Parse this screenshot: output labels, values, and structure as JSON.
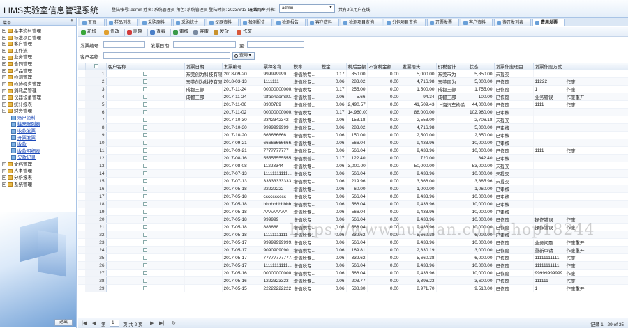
{
  "header": {
    "title": "LIMS实验室信息管理系统",
    "user_info": "登陆帐号: admin 姓名: 系统管理员 角色: 系统管理员 登陆时间: 2023/6/13 16:32:54",
    "switch_label": "在线用户列表:",
    "switch_value": "admin",
    "online_text": "共有2位用户在线"
  },
  "sidebar": {
    "title": "菜单",
    "collapse": "«",
    "logout": "退出",
    "items": [
      {
        "label": "基本资料管理",
        "level": 0,
        "exp": "+"
      },
      {
        "label": "标准项目管理",
        "level": 0,
        "exp": "+"
      },
      {
        "label": "客户管理",
        "level": 0,
        "exp": "+"
      },
      {
        "label": "工作流",
        "level": 0,
        "exp": "+"
      },
      {
        "label": "业务管理",
        "level": 0,
        "exp": "+"
      },
      {
        "label": "合同管理",
        "level": 0,
        "exp": "+"
      },
      {
        "label": "样品管理",
        "level": 0,
        "exp": "+"
      },
      {
        "label": "检测管理",
        "level": 0,
        "exp": "+"
      },
      {
        "label": "检验报告管理",
        "level": 0,
        "exp": "+"
      },
      {
        "label": "消耗品管理",
        "level": 0,
        "exp": "+"
      },
      {
        "label": "仪器设备管理",
        "level": 0,
        "exp": "+"
      },
      {
        "label": "统计报表",
        "level": 0,
        "exp": "+"
      },
      {
        "label": "财务管理",
        "level": 0,
        "exp": "-"
      },
      {
        "label": "账户资料",
        "level": 1
      },
      {
        "label": "往来账列表",
        "level": 1
      },
      {
        "label": "收款发票",
        "level": 1
      },
      {
        "label": "开票发票",
        "level": 1
      },
      {
        "label": "收款",
        "level": 1
      },
      {
        "label": "收款明细表",
        "level": 1
      },
      {
        "label": "欠款记录",
        "level": 1
      },
      {
        "label": "文档管理",
        "level": 0,
        "exp": "+"
      },
      {
        "label": "人事管理",
        "level": 0,
        "exp": "+"
      },
      {
        "label": "分析报表",
        "level": 0,
        "exp": "+"
      },
      {
        "label": "系统管理",
        "level": 0,
        "exp": "+"
      }
    ]
  },
  "tabs": [
    "首页",
    "样品列表",
    "采购原料",
    "采购统计",
    "仪器资料",
    "检测报告",
    "检测报告",
    "客户资料",
    "检测项目查询",
    "分包项目查询",
    "开票发票",
    "客户资料",
    "待开发列表",
    "费用发票"
  ],
  "toolbar": {
    "add": "新增",
    "edit": "修改",
    "delete": "删除",
    "view": "查看",
    "audit": "审核",
    "reaudit": "弃审",
    "issue": "发放",
    "void": "作废"
  },
  "filter": {
    "invoice_no_label": "发票编号:",
    "invoice_date_label": "发票日期:",
    "to_label": "至:",
    "customer_label": "客户名称:",
    "search": "查询"
  },
  "table": {
    "columns": [
      "",
      "",
      "客户名称",
      "发票日期",
      "发票编号",
      "票种名称",
      "税率",
      "税金",
      "税后金额",
      "不含税金额",
      "发票抬头",
      "价税合计",
      "状态",
      "发票作废理由",
      "发票作废方式"
    ],
    "rows": [
      [
        "1",
        "东莞创为科技有限公司",
        "2018-09-20",
        "999999999",
        "增值税专...",
        "0.17",
        "850.00",
        "0.00",
        "5,000.00",
        "东莞市为",
        "5,850.00",
        "未提交",
        "",
        ""
      ],
      [
        "2",
        "东莞创为科技有限公司",
        "2018-03-13",
        "1111111",
        "增值税专...",
        "0.06",
        "283.02",
        "0.00",
        "4,716.98",
        "东莞南为",
        "5,000.00",
        "已作废",
        "11222",
        "作废"
      ],
      [
        "3",
        "成都三部",
        "2017-11-24",
        "00000000000...",
        "增值税专...",
        "0.17",
        "255.00",
        "0.00",
        "1,500.00",
        "成都三部",
        "1,755.00",
        "已作废",
        "1",
        "作废"
      ],
      [
        "4",
        "成都三部",
        "2017-11-24",
        "fafaehaoma0...",
        "增值税普...",
        "0.06",
        "5.66",
        "0.00",
        "94.34",
        "成都三部",
        "100.00",
        "已作废",
        "业务错误",
        "作废重开"
      ],
      [
        "5",
        "",
        "2017-11-06",
        "8900789",
        "增值税普...",
        "0.06",
        "2,490.57",
        "0.00",
        "41,509.43",
        "上海汽车检验",
        "44,000.00",
        "已作废",
        "1111",
        "作废"
      ],
      [
        "6",
        "",
        "2017-11-02",
        "00000000000...",
        "增值税专...",
        "0.17",
        "14,960.00",
        "0.00",
        "88,000.00",
        "",
        "102,960.00",
        "已审核",
        "",
        ""
      ],
      [
        "7",
        "",
        "2017-10-30",
        "2342342342",
        "增值税专...",
        "0.06",
        "153.18",
        "0.00",
        "2,553.00",
        "",
        "2,706.18",
        "未提交",
        "",
        ""
      ],
      [
        "8",
        "",
        "2017-10-30",
        "9999999999",
        "增值税专...",
        "0.06",
        "283.02",
        "0.00",
        "4,716.98",
        "",
        "5,000.00",
        "已审核",
        "",
        ""
      ],
      [
        "9",
        "",
        "2017-10-20",
        "666666666",
        "增值税专...",
        "0.06",
        "150.00",
        "0.00",
        "2,500.00",
        "",
        "2,650.00",
        "已审核",
        "",
        ""
      ],
      [
        "10",
        "",
        "2017-09-21",
        "66666666666...",
        "增值税专...",
        "0.06",
        "566.04",
        "0.00",
        "9,433.96",
        "",
        "10,000.00",
        "已审核",
        "",
        ""
      ],
      [
        "11",
        "",
        "2017-09-21",
        "7777777777",
        "增值税专...",
        "0.06",
        "566.04",
        "0.00",
        "9,433.96",
        "",
        "10,000.00",
        "已作废",
        "1111",
        "作废"
      ],
      [
        "12",
        "",
        "2017-08-16",
        "55555555555...",
        "增值税普...",
        "0.17",
        "122.40",
        "0.00",
        "720.00",
        "",
        "842.40",
        "已审核",
        "",
        ""
      ],
      [
        "13",
        "",
        "2017-08-08",
        "11223344",
        "增值税专...",
        "0.06",
        "3,000.00",
        "0.00",
        "50,000.00",
        "",
        "53,000.00",
        "未提交",
        "",
        ""
      ],
      [
        "14",
        "",
        "2017-07-13",
        "11111111111...",
        "增值税专...",
        "0.06",
        "566.04",
        "0.00",
        "9,433.96",
        "",
        "10,000.00",
        "未提交",
        "",
        ""
      ],
      [
        "15",
        "",
        "2017-07-13",
        "33333333333...",
        "增值税专...",
        "0.06",
        "219.96",
        "0.00",
        "3,666.00",
        "",
        "3,885.96",
        "未提交",
        "",
        ""
      ],
      [
        "16",
        "",
        "2017-05-18",
        "22222222",
        "增值税专...",
        "0.06",
        "60.00",
        "0.00",
        "1,000.00",
        "",
        "1,060.00",
        "已审核",
        "",
        ""
      ],
      [
        "17",
        "",
        "2017-05-18",
        "cccccccccc",
        "增值税专...",
        "0.06",
        "566.04",
        "0.00",
        "9,433.96",
        "",
        "10,000.00",
        "已审核",
        "",
        ""
      ],
      [
        "18",
        "",
        "2017-05-18",
        "bbbbbbbbbbb",
        "增值税专...",
        "0.06",
        "566.04",
        "0.00",
        "9,433.96",
        "",
        "10,000.00",
        "已审核",
        "",
        ""
      ],
      [
        "19",
        "",
        "2017-05-18",
        "AAAAAAAA",
        "增值税专...",
        "0.06",
        "566.04",
        "0.00",
        "9,433.96",
        "",
        "10,000.00",
        "已审核",
        "",
        ""
      ],
      [
        "20",
        "",
        "2017-05-18",
        "999999",
        "增值税专...",
        "0.06",
        "566.04",
        "0.00",
        "9,433.96",
        "",
        "10,000.00",
        "已作废",
        "操作错误",
        "作废"
      ],
      [
        "21",
        "",
        "2017-05-18",
        "888888",
        "增值税专...",
        "0.06",
        "566.04",
        "0.00",
        "9,433.96",
        "",
        "10,000.00",
        "已作废",
        "操作错误",
        "作废"
      ],
      [
        "22",
        "",
        "2017-05-18",
        "11111111111",
        "增值税专...",
        "0.06",
        "339.62",
        "0.00",
        "5,660.38",
        "",
        "6,000.00",
        "已审核",
        "",
        ""
      ],
      [
        "23",
        "",
        "2017-05-17",
        "99999999999...",
        "增值税专...",
        "0.06",
        "566.04",
        "0.00",
        "9,433.96",
        "",
        "10,000.00",
        "已作废",
        "业务问题",
        "作废重开"
      ],
      [
        "24",
        "",
        "2017-05-17",
        "9090909090",
        "增值税专...",
        "0.06",
        "169.81",
        "0.00",
        "2,830.19",
        "",
        "3,000.00",
        "已作废",
        "重新审请",
        "作废重开"
      ],
      [
        "25",
        "",
        "2017-05-17",
        "77777777777...",
        "增值税专...",
        "0.06",
        "339.62",
        "0.00",
        "5,660.38",
        "",
        "6,000.00",
        "已作废",
        "11111111111",
        "作废"
      ],
      [
        "26",
        "",
        "2017-05-17",
        "11111111111...",
        "增值税专...",
        "0.06",
        "566.04",
        "0.00",
        "9,433.96",
        "",
        "10,000.00",
        "已作废",
        "11111111111",
        "作废"
      ],
      [
        "27",
        "",
        "2017-05-16",
        "00000000000...",
        "增值税专...",
        "0.06",
        "566.04",
        "0.00",
        "9,433.96",
        "",
        "10,000.00",
        "已作废",
        "99999999999...",
        "作废"
      ],
      [
        "28",
        "",
        "2017-05-16",
        "1222323323",
        "增值税专...",
        "0.06",
        "203.77",
        "0.00",
        "3,396.23",
        "",
        "3,600.00",
        "已作废",
        "111111",
        "作废"
      ],
      [
        "29",
        "",
        "2017-05-15",
        "22222222222",
        "增值税专...",
        "0.06",
        "538.30",
        "0.00",
        "8,971.70",
        "",
        "9,510.00",
        "已作废",
        "1",
        "作废重开"
      ]
    ]
  },
  "pager": {
    "page_label": "第",
    "page_value": "1",
    "page_total": "页,共 2 页",
    "records": "记录 1 - 29 of 35"
  },
  "watermark": "https://www.huzhan.com/shop18244"
}
